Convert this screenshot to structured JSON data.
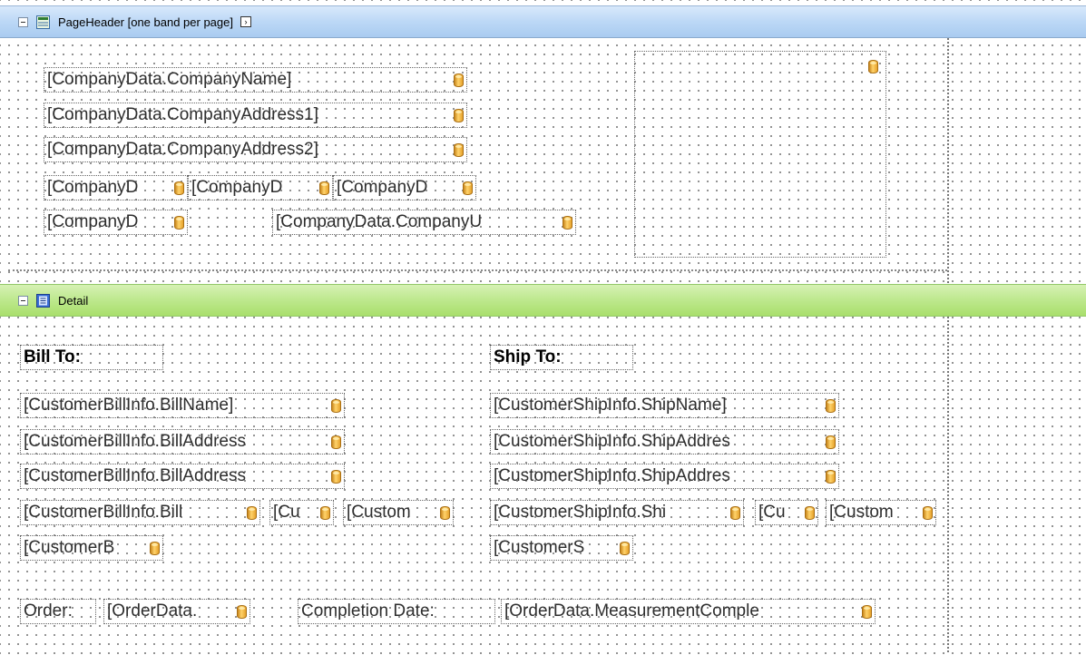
{
  "page_header": {
    "title": "PageHeader [one band per page]",
    "company_fields": [
      "[CompanyData.CompanyName]",
      "[CompanyData.CompanyAddress1]",
      "[CompanyData.CompanyAddress2]",
      "[CompanyD",
      "[CompanyD",
      "[CompanyD",
      "[CompanyD",
      "[CompanyData.CompanyU"
    ]
  },
  "detail": {
    "title": "Detail",
    "bill_to_label": "Bill To:",
    "ship_to_label": "Ship To:",
    "bill_fields": [
      "[CustomerBillInfo.BillName]",
      "[CustomerBillInfo.BillAddress",
      "[CustomerBillInfo.BillAddress",
      "[CustomerBillInfo.Bill",
      "[Cu",
      "[Custom",
      "[CustomerB"
    ],
    "ship_fields": [
      "[CustomerShipInfo.ShipName]",
      "[CustomerShipInfo.ShipAddres",
      "[CustomerShipInfo.ShipAddres",
      "[CustomerShipInfo.Shi",
      "[Cu",
      "[Custom",
      "[CustomerS"
    ],
    "order_label": "Order:",
    "order_field": "[OrderData.",
    "completion_label": "Completion Date:",
    "completion_field": "[OrderData.MeasurementComple"
  },
  "icons": {
    "field_icon": "database-field-icon",
    "page_header_icon": "page-header-band-icon",
    "detail_icon": "detail-band-icon"
  },
  "colors": {
    "page_header_band": "#bcd8f6",
    "detail_band": "#bde88d",
    "field_icon": "#f2b33d"
  }
}
